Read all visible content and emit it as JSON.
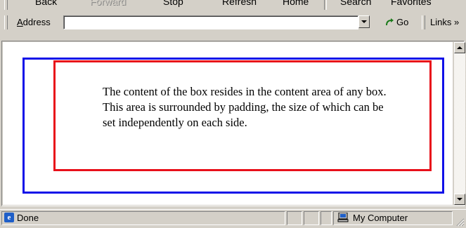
{
  "toolbar": {
    "back": "Back",
    "forward": "Forward",
    "stop": "Stop",
    "refresh": "Refresh",
    "home": "Home",
    "search": "Search",
    "favorites": "Favorites"
  },
  "address_bar": {
    "label": "Address",
    "value": "",
    "go_label": "Go",
    "links_label": "Links »"
  },
  "page": {
    "text": "The content of the box resides in the content area of any box. This area is surrounded by padding, the size of which can be set independently on each side.",
    "outer_box_color": "#1010e8",
    "inner_box_color": "#e8101a"
  },
  "status_bar": {
    "status": "Done",
    "zone": "My Computer"
  }
}
